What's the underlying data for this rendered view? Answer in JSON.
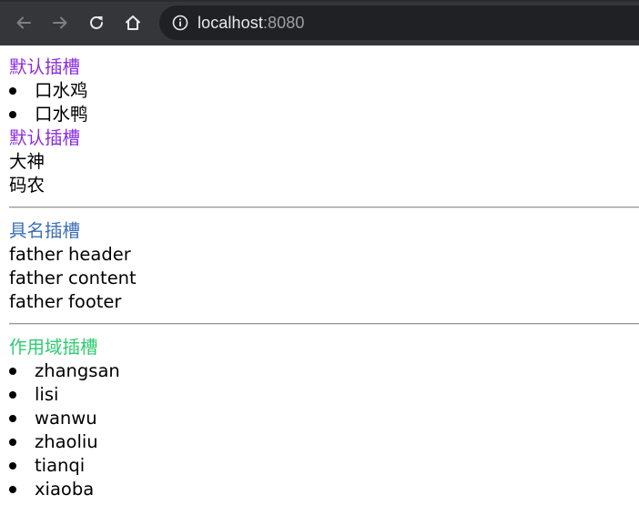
{
  "browser": {
    "url_host": "localhost",
    "url_port": ":8080",
    "icons": {
      "back": "arrow-left-icon",
      "forward": "arrow-right-icon",
      "reload": "reload-icon",
      "home": "home-icon",
      "info": "info-icon"
    },
    "colors": {
      "toolbar_bg": "#35363a",
      "omnibox_bg": "#202124"
    }
  },
  "default_slot": {
    "title_1": "默认插槽",
    "items": [
      "口水鸡",
      "口水鸭"
    ],
    "title_2": "默认插槽",
    "lines": [
      "大神",
      "码农"
    ],
    "title_color": "#8a2be2"
  },
  "named_slot": {
    "title": "具名插槽",
    "header": "father header",
    "content": "father content",
    "footer": "father footer",
    "title_color": "#3a6fb5"
  },
  "scoped_slot": {
    "title": "作用域插槽",
    "items": [
      "zhangsan",
      "lisi",
      "wanwu",
      "zhaoliu",
      "tianqi",
      "xiaoba"
    ],
    "title_color": "#2ecc71"
  }
}
